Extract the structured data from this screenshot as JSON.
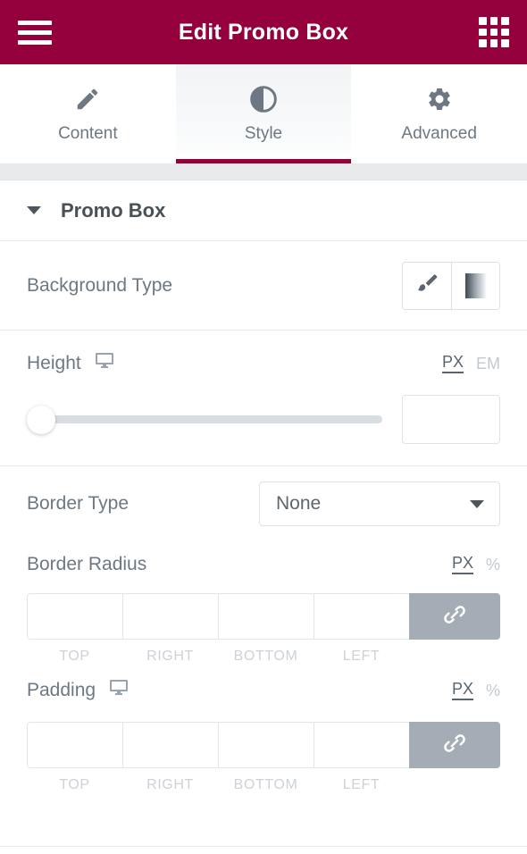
{
  "header": {
    "title": "Edit Promo Box",
    "menu_icon": "hamburger-menu-icon",
    "apps_icon": "grid-apps-icon"
  },
  "tabs": [
    {
      "label": "Content",
      "icon": "pencil-icon",
      "active": false
    },
    {
      "label": "Style",
      "icon": "contrast-icon",
      "active": true
    },
    {
      "label": "Advanced",
      "icon": "gear-icon",
      "active": false
    }
  ],
  "section": {
    "title": "Promo Box",
    "collapse_icon": "caret-down-icon"
  },
  "controls": {
    "background_type": {
      "label": "Background Type",
      "options": [
        {
          "icon": "paint-brush-icon",
          "name": "classic"
        },
        {
          "icon": "gradient-swatch-icon",
          "name": "gradient"
        }
      ]
    },
    "height": {
      "label": "Height",
      "device_icon": "desktop-monitor-icon",
      "units": [
        {
          "label": "PX",
          "active": true
        },
        {
          "label": "EM",
          "active": false
        }
      ],
      "value": "",
      "slider_position_percent": 0
    },
    "border_type": {
      "label": "Border Type",
      "value": "None",
      "caret_icon": "caret-down-icon"
    },
    "border_radius": {
      "label": "Border Radius",
      "units": [
        {
          "label": "PX",
          "active": true
        },
        {
          "label": "%",
          "active": false
        }
      ],
      "fields": [
        {
          "caption": "TOP",
          "value": ""
        },
        {
          "caption": "RIGHT",
          "value": ""
        },
        {
          "caption": "BOTTOM",
          "value": ""
        },
        {
          "caption": "LEFT",
          "value": ""
        }
      ],
      "link_icon": "link-chain-icon"
    },
    "padding": {
      "label": "Padding",
      "device_icon": "desktop-monitor-icon",
      "units": [
        {
          "label": "PX",
          "active": true
        },
        {
          "label": "%",
          "active": false
        }
      ],
      "fields": [
        {
          "caption": "TOP",
          "value": ""
        },
        {
          "caption": "RIGHT",
          "value": ""
        },
        {
          "caption": "BOTTOM",
          "value": ""
        },
        {
          "caption": "LEFT",
          "value": ""
        }
      ],
      "link_icon": "link-chain-icon"
    }
  },
  "colors": {
    "brand": "#93003c",
    "text": "#6d7882",
    "link_button": "#a4adb6"
  }
}
